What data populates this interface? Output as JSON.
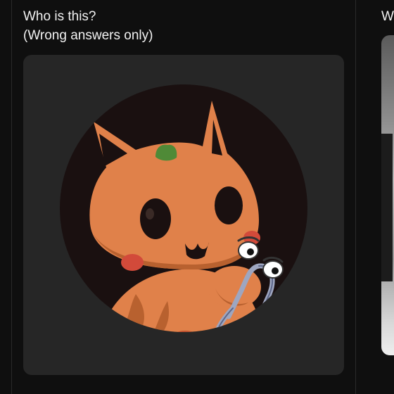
{
  "post": {
    "caption_line1": "Who is this?",
    "caption_line2": "(Wrong answers only)"
  },
  "next_post": {
    "caption_partial": "W"
  },
  "colors": {
    "background": "#0f0f0f",
    "media_bg": "#262626",
    "circle_bg": "#1a1010",
    "fox_orange": "#e0814a",
    "fox_shadow": "#b8612f",
    "leaf_green": "#4f8a37",
    "blush": "#d24a3a",
    "clip_silver": "#9ea6c0"
  },
  "icons": {
    "avatar": "orange-fox-cat-with-paperclip-icon"
  }
}
